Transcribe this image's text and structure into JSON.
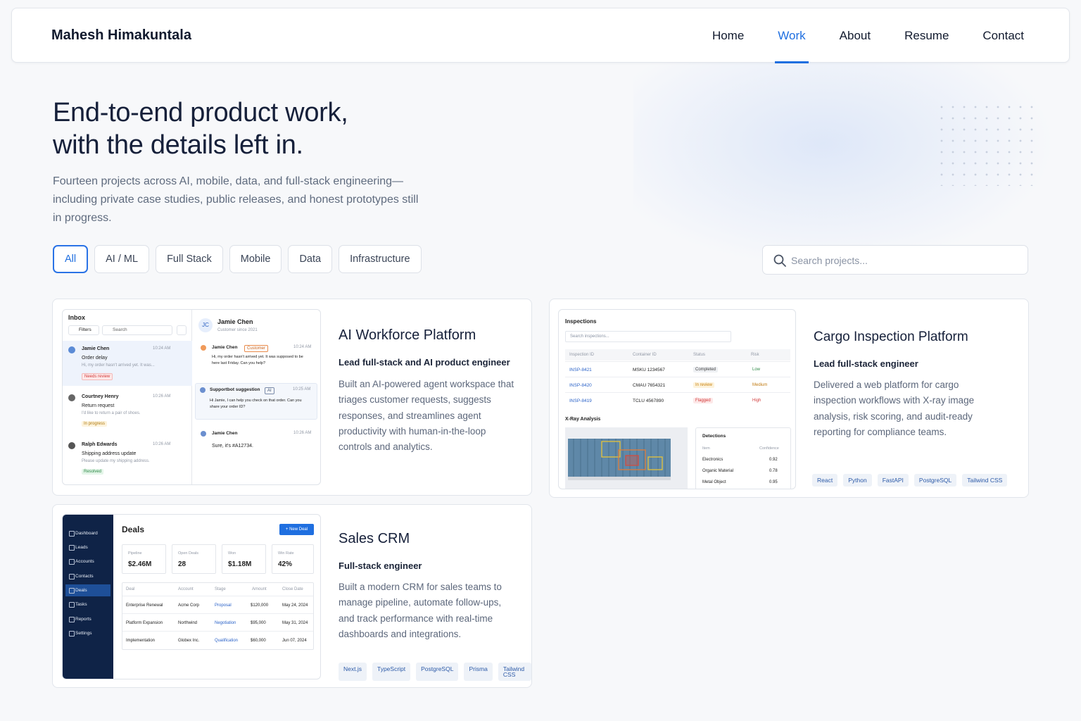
{
  "brand": "Mahesh Himakuntala",
  "nav": [
    "Home",
    "Work",
    "About",
    "Resume",
    "Contact"
  ],
  "hero": {
    "title_line1": "End-to-end product work,",
    "title_line2": "with the details left in.",
    "subtitle": "Fourteen projects across AI, mobile, data, and full-stack engineering—including private case studies, public releases, and honest prototypes still in progress."
  },
  "filters": [
    "All",
    "AI / ML",
    "Full Stack",
    "Mobile",
    "Data",
    "Infrastructure"
  ],
  "search_placeholder": "Search projects...",
  "projects": [
    {
      "title": "AI Workforce Platform",
      "role": "Lead full-stack and AI product engineer",
      "description": "Built an AI-powered agent workspace that triages customer requests, suggests responses, and streamlines agent productivity with human-in-the-loop controls and analytics.",
      "mock": {
        "inbox": "Inbox",
        "filters": "Filters",
        "search": "Search",
        "items": [
          {
            "name": "Jamie Chen",
            "time": "10:24 AM",
            "subject": "Order delay",
            "preview": "Hi, my order hasn't arrived yet. It was...",
            "status": "Needs review"
          },
          {
            "name": "Courtney Henry",
            "time": "10:26 AM",
            "subject": "Return request",
            "preview": "I'd like to return a pair of shoes.",
            "status": "In progress"
          },
          {
            "name": "Ralph Edwards",
            "time": "10:26 AM",
            "subject": "Shipping address update",
            "preview": "Please update my shipping address.",
            "status": "Resolved"
          }
        ],
        "detail_initials": "JC",
        "detail_name": "Jamie Chen",
        "detail_sub": "Customer since 2021",
        "thread": [
          {
            "name": "Jamie Chen",
            "badge": "Customer",
            "time": "10:24 AM",
            "text": "Hi, my order hasn't arrived yet. It was supposed to be here last Friday. Can you help?"
          },
          {
            "name": "Supportbot suggestion",
            "badge": "AI",
            "time": "10:25 AM",
            "text": "Hi Jamie, I can help you check on that order. Can you share your order ID?"
          },
          {
            "name": "Jamie Chen",
            "badge": "",
            "time": "10:26 AM",
            "text": "Sure, it's #A12734."
          }
        ]
      }
    },
    {
      "title": "Cargo Inspection Platform",
      "role": "Lead full-stack engineer",
      "description": "Delivered a web platform for cargo inspection workflows with X-ray image analysis, risk scoring, and audit-ready reporting for compliance teams.",
      "tags": [
        "React",
        "Python",
        "FastAPI",
        "PostgreSQL",
        "Tailwind CSS"
      ],
      "mock": {
        "heading": "Inspections",
        "search": "Search inspections...",
        "columns": [
          "Inspection ID",
          "Container ID",
          "Status",
          "Risk"
        ],
        "rows": [
          [
            "INSP-8421",
            "MSKU 1234567",
            "Completed",
            "Low"
          ],
          [
            "INSP-8420",
            "CMAU 7654321",
            "In review",
            "Medium"
          ],
          [
            "INSP-8419",
            "TCLU 4567890",
            "Flagged",
            "High"
          ]
        ],
        "xray": "X-Ray Analysis",
        "detections_title": "Detections",
        "det_columns": [
          "Item",
          "Confidence"
        ],
        "detections": [
          [
            "Electronics",
            "0.92"
          ],
          [
            "Organic Material",
            "0.78"
          ],
          [
            "Metal Object",
            "0.95"
          ]
        ]
      }
    },
    {
      "title": "Sales CRM",
      "role": "Full-stack engineer",
      "description": "Built a modern CRM for sales teams to manage pipeline, automate follow-ups, and track performance with real-time dashboards and integrations.",
      "tags": [
        "Next.js",
        "TypeScript",
        "PostgreSQL",
        "Prisma",
        "Tailwind CSS"
      ],
      "mock": {
        "sidebar": [
          "Dashboard",
          "Leads",
          "Accounts",
          "Contacts",
          "Deals",
          "Tasks",
          "Reports",
          "Settings"
        ],
        "heading": "Deals",
        "new_button": "+ New Deal",
        "stats": [
          [
            "Pipeline",
            "$2.46M"
          ],
          [
            "Open Deals",
            "28"
          ],
          [
            "Won",
            "$1.18M"
          ],
          [
            "Win Rate",
            "42%"
          ]
        ],
        "columns": [
          "Deal",
          "Account",
          "Stage",
          "Amount",
          "Close Date"
        ],
        "rows": [
          [
            "Enterprise Renewal",
            "Acme Corp",
            "Proposal",
            "$120,000",
            "May 24, 2024"
          ],
          [
            "Platform Expansion",
            "Northwind",
            "Negotiation",
            "$95,000",
            "May 31, 2024"
          ],
          [
            "Implementation",
            "Globex Inc.",
            "Qualification",
            "$60,000",
            "Jun 07, 2024"
          ]
        ]
      }
    }
  ],
  "colors": {
    "accent": "#1f6fe0",
    "text": "#16203a",
    "muted": "#5c677b",
    "sidebar": "#0f2347"
  }
}
